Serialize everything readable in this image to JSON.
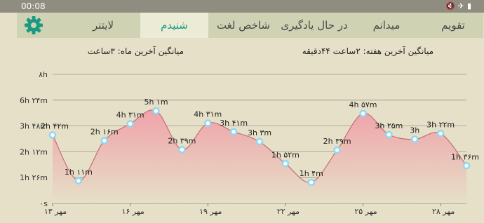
{
  "status_bar": {
    "time": "00:08",
    "icons": [
      "mute-icon",
      "airplane-icon",
      "battery-icon"
    ]
  },
  "tabs": [
    {
      "label": "تقویم",
      "active": false
    },
    {
      "label": "میدانم",
      "active": false
    },
    {
      "label": "در حال یادگیری",
      "active": false
    },
    {
      "label": "شاخص لغت",
      "active": false
    },
    {
      "label": "شنیدم",
      "active": true
    },
    {
      "label": "لایتنر",
      "active": false
    }
  ],
  "settings_icon": "gear-icon",
  "colors": {
    "accent": "#1a9a82",
    "tab_bar": "#cfd3b3",
    "active_tab": "#ecebd6",
    "background": "#e6e0c8",
    "fill_top": "#f0a0a8",
    "point": "#bfe9f7"
  },
  "stats": {
    "weekly_avg": "میانگین آخرین هفته: ۲ساعت  ۴۴دقیقه",
    "monthly_avg": "میانگین آخرین ماه: ۳ساعت"
  },
  "chart_data": {
    "type": "area",
    "y_tick_labels": [
      "۰s",
      "1h ۲۶m",
      "2h ۱۲m",
      "3h ۴۸m",
      "6h ۲۴m",
      "۸h"
    ],
    "x_tick_labels": [
      "۱۳ مهر",
      "۱۶ مهر",
      "۱۹ مهر",
      "۲۲ مهر",
      "۲۵ مهر",
      "۲۸ مهر"
    ],
    "ylim": [
      0,
      6
    ],
    "grid": true,
    "x": [
      0,
      1,
      2,
      3,
      4,
      5,
      6,
      7,
      8,
      9,
      10,
      11,
      12,
      13,
      14,
      15
    ],
    "values": [
      3.18,
      1.05,
      2.92,
      3.7,
      4.3,
      2.5,
      3.73,
      3.33,
      2.87,
      1.85,
      0.98,
      2.48,
      4.18,
      3.2,
      2.98,
      3.25,
      1.75
    ],
    "point_labels": [
      "2h ۴۲m",
      "1h ۱۱m",
      "2h ۱۶m",
      "4h ۳۱m",
      "5h ۱m",
      "2h ۳۹m",
      "4h ۳۱m",
      "3h ۴۱m",
      "3h ۳m",
      "1h ۵۲m",
      "1h ۴m",
      "2h ۳۹m",
      "4h ۵۷m",
      "3h ۲۵m",
      "3h",
      "3h ۲۲m",
      "1h ۳۶m"
    ]
  }
}
